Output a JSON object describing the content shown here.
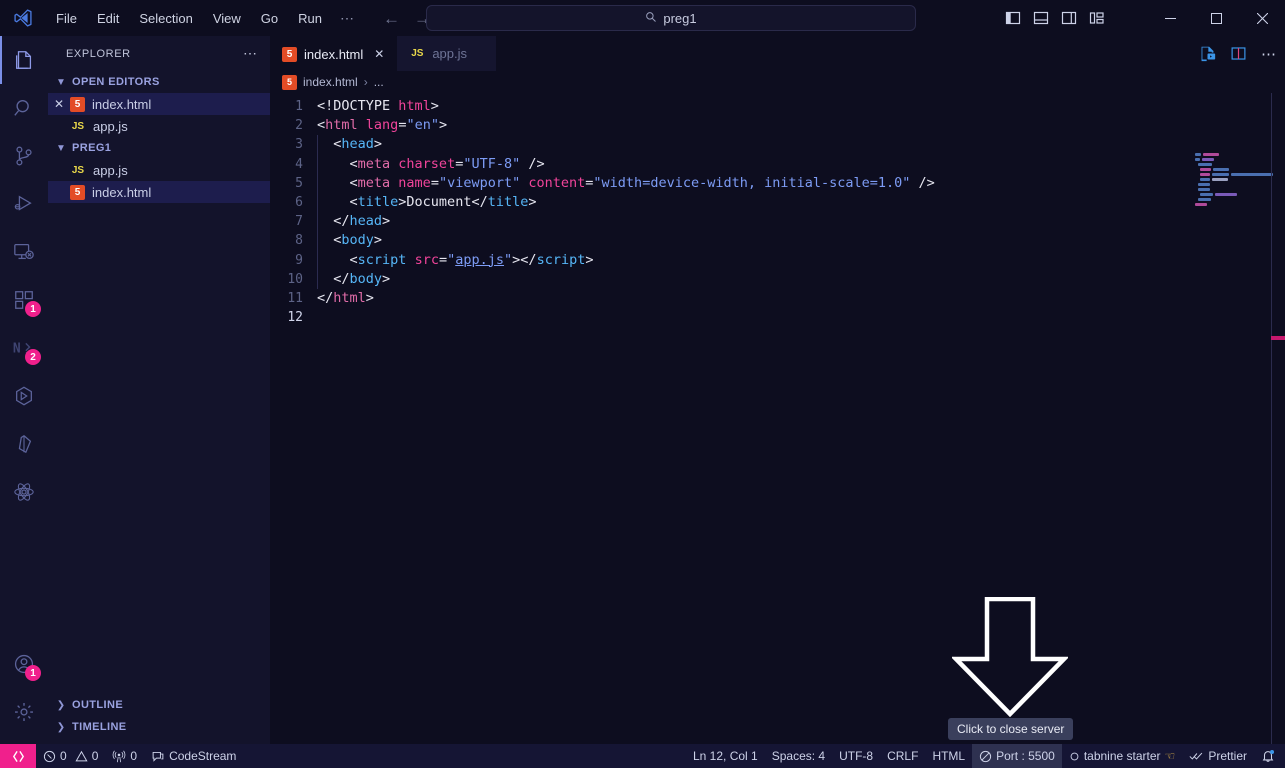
{
  "titlebar": {
    "logo_icon": "vscode-logo-icon",
    "menus": [
      "File",
      "Edit",
      "Selection",
      "View",
      "Go",
      "Run"
    ],
    "overflow_label": "⋯",
    "back_icon": "arrow-left-icon",
    "forward_icon": "arrow-right-icon",
    "command_center": {
      "icon": "search-icon",
      "value": "preg1"
    },
    "layout_icons": [
      "toggle-primary-sidebar-icon",
      "toggle-panel-icon",
      "toggle-secondary-sidebar-icon",
      "customize-layout-icon"
    ],
    "window_controls": {
      "minimize": "—",
      "maximize": "☐",
      "close": "✕"
    }
  },
  "activitybar": {
    "items": [
      {
        "name": "explorer",
        "icon": "files-icon",
        "active": true,
        "badge": ""
      },
      {
        "name": "search",
        "icon": "search-icon",
        "active": false,
        "badge": ""
      },
      {
        "name": "source-control",
        "icon": "source-control-icon",
        "active": false,
        "badge": ""
      },
      {
        "name": "run-and-debug",
        "icon": "run-debug-icon",
        "active": false,
        "badge": ""
      },
      {
        "name": "remote-explorer",
        "icon": "remote-explorer-icon",
        "active": false,
        "badge": ""
      },
      {
        "name": "extensions",
        "icon": "extensions-icon",
        "active": false,
        "badge": "1"
      },
      {
        "name": "nx-console",
        "icon": "nx-icon",
        "active": false,
        "badge": "2"
      },
      {
        "name": "docker",
        "icon": "docker-cube-icon",
        "active": false,
        "badge": ""
      },
      {
        "name": "prisma",
        "icon": "prisma-icon",
        "active": false,
        "badge": ""
      },
      {
        "name": "react-tools",
        "icon": "react-atom-icon",
        "active": false,
        "badge": ""
      }
    ],
    "bottom_items": [
      {
        "name": "accounts",
        "icon": "account-icon",
        "badge": "1"
      },
      {
        "name": "manage-settings",
        "icon": "gear-icon",
        "badge": ""
      }
    ]
  },
  "sidebar": {
    "title": "EXPLORER",
    "actions_icon": "more-actions-icon",
    "sections": [
      {
        "label": "OPEN EDITORS",
        "expanded": true,
        "chevron": "⌄",
        "items": [
          {
            "name": "index.html",
            "icon": "html5-icon",
            "icon_text": "5",
            "closable": true,
            "selected": true
          },
          {
            "name": "app.js",
            "icon": "javascript-icon",
            "icon_text": "JS",
            "closable": false,
            "selected": false
          }
        ]
      },
      {
        "label": "PREG1",
        "expanded": true,
        "chevron": "⌄",
        "items": [
          {
            "name": "app.js",
            "icon": "javascript-icon",
            "icon_text": "JS",
            "closable": false,
            "selected": false
          },
          {
            "name": "index.html",
            "icon": "html5-icon",
            "icon_text": "5",
            "closable": false,
            "selected": true
          }
        ]
      }
    ],
    "bottom_sections": [
      {
        "label": "OUTLINE",
        "chevron": "›"
      },
      {
        "label": "TIMELINE",
        "chevron": "›"
      }
    ]
  },
  "editor": {
    "tabs": [
      {
        "label": "index.html",
        "icon": "html5-icon",
        "icon_text": "5",
        "active": true,
        "closable": true
      },
      {
        "label": "app.js",
        "icon": "javascript-icon",
        "icon_text": "JS",
        "active": false,
        "closable": false
      }
    ],
    "tab_actions": [
      "open-preview-icon",
      "split-editor-icon",
      "more-actions-icon"
    ],
    "breadcrumb": {
      "file": "index.html",
      "separator": "›",
      "more": "..."
    },
    "lines": [
      {
        "num": "1",
        "indent": 0,
        "tokens": [
          {
            "t": "<!DOCTYPE ",
            "c": "t-punct"
          },
          {
            "t": "html",
            "c": "t-attr"
          },
          {
            "t": ">",
            "c": "t-punct"
          }
        ]
      },
      {
        "num": "2",
        "indent": 0,
        "tokens": [
          {
            "t": "<",
            "c": "t-punct"
          },
          {
            "t": "html",
            "c": "t-tagp"
          },
          {
            "t": " ",
            "c": "t-punct"
          },
          {
            "t": "lang",
            "c": "t-attr"
          },
          {
            "t": "=",
            "c": "t-eq"
          },
          {
            "t": "\"en\"",
            "c": "t-str"
          },
          {
            "t": ">",
            "c": "t-punct"
          }
        ]
      },
      {
        "num": "3",
        "indent": 1,
        "tokens": [
          {
            "t": "  <",
            "c": "t-punct"
          },
          {
            "t": "head",
            "c": "t-tag"
          },
          {
            "t": ">",
            "c": "t-punct"
          }
        ]
      },
      {
        "num": "4",
        "indent": 1,
        "tokens": [
          {
            "t": "    <",
            "c": "t-punct"
          },
          {
            "t": "meta",
            "c": "t-tagp"
          },
          {
            "t": " ",
            "c": "t-punct"
          },
          {
            "t": "charset",
            "c": "t-attr"
          },
          {
            "t": "=",
            "c": "t-eq"
          },
          {
            "t": "\"UTF-8\"",
            "c": "t-str"
          },
          {
            "t": " />",
            "c": "t-punct"
          }
        ]
      },
      {
        "num": "5",
        "indent": 1,
        "tokens": [
          {
            "t": "    <",
            "c": "t-punct"
          },
          {
            "t": "meta",
            "c": "t-tagp"
          },
          {
            "t": " ",
            "c": "t-punct"
          },
          {
            "t": "name",
            "c": "t-attr"
          },
          {
            "t": "=",
            "c": "t-eq"
          },
          {
            "t": "\"viewport\"",
            "c": "t-str"
          },
          {
            "t": " ",
            "c": "t-punct"
          },
          {
            "t": "content",
            "c": "t-attr"
          },
          {
            "t": "=",
            "c": "t-eq"
          },
          {
            "t": "\"width=device-width, initial-scale=1.0\"",
            "c": "t-str"
          },
          {
            "t": " />",
            "c": "t-punct"
          }
        ]
      },
      {
        "num": "6",
        "indent": 1,
        "tokens": [
          {
            "t": "    <",
            "c": "t-punct"
          },
          {
            "t": "title",
            "c": "t-tag"
          },
          {
            "t": ">",
            "c": "t-punct"
          },
          {
            "t": "Document",
            "c": "t-txt"
          },
          {
            "t": "</",
            "c": "t-punct"
          },
          {
            "t": "title",
            "c": "t-tag"
          },
          {
            "t": ">",
            "c": "t-punct"
          }
        ]
      },
      {
        "num": "7",
        "indent": 1,
        "tokens": [
          {
            "t": "  </",
            "c": "t-punct"
          },
          {
            "t": "head",
            "c": "t-tag"
          },
          {
            "t": ">",
            "c": "t-punct"
          }
        ]
      },
      {
        "num": "8",
        "indent": 1,
        "tokens": [
          {
            "t": "  <",
            "c": "t-punct"
          },
          {
            "t": "body",
            "c": "t-tag"
          },
          {
            "t": ">",
            "c": "t-punct"
          }
        ]
      },
      {
        "num": "9",
        "indent": 1,
        "tokens": [
          {
            "t": "    <",
            "c": "t-punct"
          },
          {
            "t": "script",
            "c": "t-tag"
          },
          {
            "t": " ",
            "c": "t-punct"
          },
          {
            "t": "src",
            "c": "t-attr"
          },
          {
            "t": "=",
            "c": "t-eq"
          },
          {
            "t": "\"",
            "c": "t-str"
          },
          {
            "t": "app.js",
            "c": "t-link"
          },
          {
            "t": "\"",
            "c": "t-str"
          },
          {
            "t": ">",
            "c": "t-punct"
          },
          {
            "t": "</",
            "c": "t-punct"
          },
          {
            "t": "script",
            "c": "t-tag"
          },
          {
            "t": ">",
            "c": "t-punct"
          }
        ]
      },
      {
        "num": "10",
        "indent": 1,
        "tokens": [
          {
            "t": "  </",
            "c": "t-punct"
          },
          {
            "t": "body",
            "c": "t-tag"
          },
          {
            "t": ">",
            "c": "t-punct"
          }
        ]
      },
      {
        "num": "11",
        "indent": 0,
        "tokens": [
          {
            "t": "</",
            "c": "t-punct"
          },
          {
            "t": "html",
            "c": "t-tagp"
          },
          {
            "t": ">",
            "c": "t-punct"
          }
        ]
      },
      {
        "num": "12",
        "indent": 0,
        "current": true,
        "tokens": []
      }
    ]
  },
  "annotation": {
    "arrow_icon": "down-arrow-annotation",
    "tooltip": "Click to close server"
  },
  "statusbar": {
    "remote_icon": "remote-window-icon",
    "left": [
      {
        "name": "problems",
        "icon": "error-icon",
        "text": "0",
        "icon2": "warning-icon",
        "text2": "0"
      },
      {
        "name": "ports",
        "icon": "radio-tower-icon",
        "text": "0"
      },
      {
        "name": "codestream",
        "icon": "comment-icon",
        "text": "CodeStream"
      }
    ],
    "right": [
      {
        "name": "cursor-position",
        "text": "Ln 12, Col 1"
      },
      {
        "name": "indentation",
        "text": "Spaces: 4"
      },
      {
        "name": "encoding",
        "text": "UTF-8"
      },
      {
        "name": "eol",
        "text": "CRLF"
      },
      {
        "name": "language-mode",
        "text": "HTML"
      },
      {
        "name": "live-server-port",
        "text": "Port : 5500",
        "icon": "circle-slash-icon",
        "highlight": true
      },
      {
        "name": "tabnine",
        "text": "tabnine starter",
        "icon": "tabnine-icon",
        "suffix": "👍"
      },
      {
        "name": "prettier",
        "text": "Prettier",
        "icon": "checks-icon"
      },
      {
        "name": "notifications",
        "text": "",
        "icon": "bell-dot-icon"
      }
    ]
  },
  "colors": {
    "accent_pink": "#f0208c",
    "bg": "#0d0d1f",
    "panel": "#13132b",
    "statusbar": "#151534",
    "selection": "#1d1d4d"
  }
}
